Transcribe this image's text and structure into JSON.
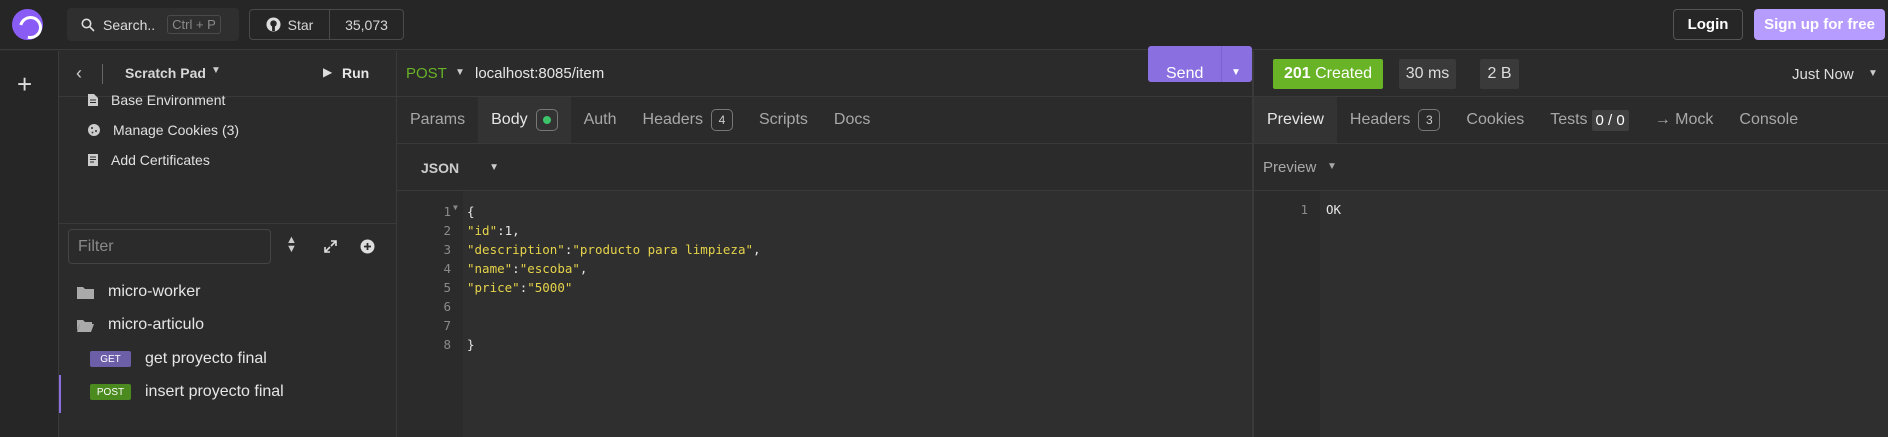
{
  "topbar": {
    "search_label": "Search..",
    "search_shortcut": "Ctrl + P",
    "star_label": "Star",
    "star_count": "35,073",
    "login_label": "Login",
    "signup_label": "Sign up for free"
  },
  "sidebar": {
    "title": "Scratch Pad",
    "run_label": "Run",
    "items": [
      {
        "label": "Base Environment",
        "icon": "document-icon"
      },
      {
        "label": "Manage Cookies (3)",
        "icon": "cookie-icon"
      },
      {
        "label": "Add Certificates",
        "icon": "certificate-icon"
      }
    ],
    "filter_placeholder": "Filter",
    "tree": [
      {
        "label": "micro-worker",
        "type": "folder"
      },
      {
        "label": "micro-articulo",
        "type": "folder-open"
      },
      {
        "label": "get proyecto final",
        "method": "GET"
      },
      {
        "label": "insert proyecto final",
        "method": "POST"
      }
    ]
  },
  "request": {
    "method": "POST",
    "url": "localhost:8085/item",
    "send_label": "Send",
    "tabs": [
      {
        "label": "Params"
      },
      {
        "label": "Body"
      },
      {
        "label": "Auth"
      },
      {
        "label": "Headers",
        "count": "4"
      },
      {
        "label": "Scripts"
      },
      {
        "label": "Docs"
      }
    ],
    "body_type": "JSON",
    "line_numbers": [
      "1",
      "2",
      "3",
      "4",
      "5",
      "6",
      "7",
      "8"
    ],
    "code": {
      "l1": "{",
      "l2_key": "\"id\"",
      "l2_val": "1,",
      "l3_key": "\"description\"",
      "l3_val": "\"producto para limpieza\"",
      "l4_key": "\"name\"",
      "l4_val": "\"escoba\"",
      "l5_key": "\"price\"",
      "l5_val": "\"5000\"",
      "l8": "}"
    }
  },
  "response": {
    "status": "201 Created",
    "status_code": "201",
    "status_text": "Created",
    "time": "30 ms",
    "size": "2 B",
    "when": "Just Now",
    "tabs": [
      {
        "label": "Preview"
      },
      {
        "label": "Headers",
        "count": "3"
      },
      {
        "label": "Cookies"
      },
      {
        "label": "Tests",
        "count": "0 / 0"
      },
      {
        "label": "→ Mock"
      },
      {
        "label": "Console"
      }
    ],
    "preview_label": "Preview",
    "line_number": "1",
    "body": "OK"
  },
  "colors": {
    "accent": "#8a6fe0",
    "success": "#68b326",
    "post": "#68b326",
    "get": "#6c5fa8"
  }
}
